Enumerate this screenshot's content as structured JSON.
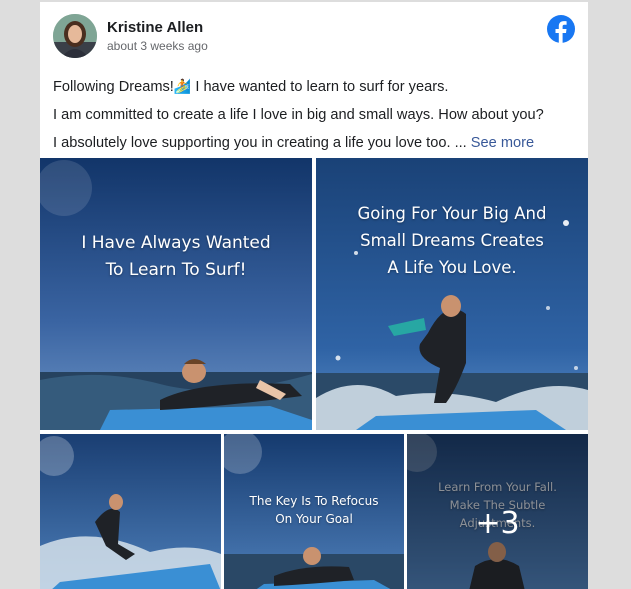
{
  "post": {
    "author": "Kristine Allen",
    "timestamp": "about 3 weeks ago",
    "logo_icon": "facebook-icon",
    "brand_color": "#1877f2",
    "text": {
      "line1": "Following Dreams!",
      "line1_emoji": "🏄",
      "line1_rest": " I have wanted to learn to surf for years.",
      "line2": "I am committed to create a life I love in big and small ways. How about you?",
      "line3": "I absolutely love supporting you in creating a life you love too. ...",
      "see_more": "See more"
    }
  },
  "photos": {
    "photo1": {
      "caption_line1": "I Have Always Wanted",
      "caption_line2": "To Learn To Surf!"
    },
    "photo2": {
      "caption_line1": "Going For Your Big And",
      "caption_line2": "Small Dreams Creates",
      "caption_line3": "A Life You Love."
    },
    "photo3": {},
    "photo4": {
      "caption_line1": "The Key Is To Refocus",
      "caption_line2": "On Your Goal"
    },
    "photo5": {
      "caption_line1": "Learn From Your Fall.",
      "caption_line2": "Make The Subtle",
      "caption_line3": "Adjustments.",
      "more_count": "+3"
    }
  }
}
